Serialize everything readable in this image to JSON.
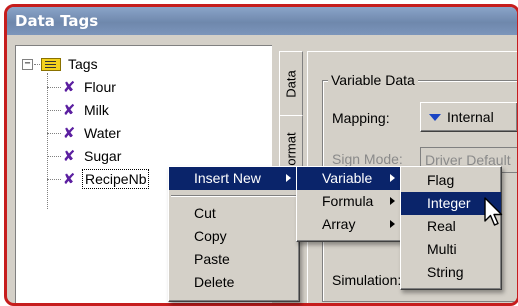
{
  "window": {
    "title": "Data Tags"
  },
  "tree": {
    "root_label": "Tags",
    "items": [
      {
        "label": "Flour"
      },
      {
        "label": "Milk"
      },
      {
        "label": "Water"
      },
      {
        "label": "Sugar"
      },
      {
        "label": "RecipeNb",
        "selected": true
      }
    ]
  },
  "tabs": {
    "data": "Data",
    "format": "Format"
  },
  "variable_data": {
    "group_title": "Variable Data",
    "mapping_label": "Mapping:",
    "mapping_value": "Internal",
    "sign_mode_label": "Sign Mode:",
    "sign_mode_value": "Driver Default",
    "simulation_label": "Simulation:"
  },
  "context_menu": {
    "insert_new": "Insert New",
    "cut": "Cut",
    "copy": "Copy",
    "paste": "Paste",
    "delete": "Delete"
  },
  "insert_submenu": {
    "variable": "Variable",
    "formula": "Formula",
    "array": "Array"
  },
  "variable_submenu": {
    "items": [
      "Flag",
      "Integer",
      "Real",
      "Multi",
      "String"
    ],
    "highlighted": "Integer"
  },
  "colors": {
    "frame_border": "#c61d1d",
    "titlebar": "#7c95bb",
    "menu_highlight": "#0a246a",
    "tag_icon": "#5b1fa0"
  }
}
